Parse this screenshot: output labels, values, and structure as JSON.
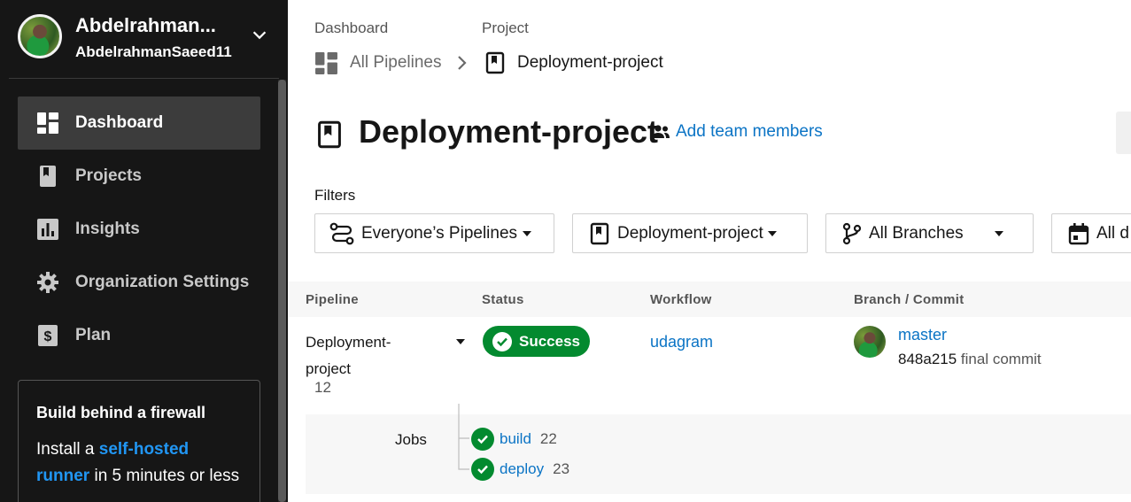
{
  "sidebar": {
    "profile": {
      "name": "Abdelrahman...",
      "username": "AbdelrahmanSaeed11"
    },
    "nav": [
      {
        "label": "Dashboard",
        "icon": "dashboard-icon",
        "active": true
      },
      {
        "label": "Projects",
        "icon": "project-icon",
        "active": false
      },
      {
        "label": "Insights",
        "icon": "insights-icon",
        "active": false
      },
      {
        "label": "Organization Settings",
        "icon": "gear-icon",
        "active": false
      },
      {
        "label": "Plan",
        "icon": "dollar-icon",
        "active": false
      }
    ],
    "promo": {
      "title": "Build behind a firewall",
      "text_before": "Install a",
      "link": "self-hosted runner",
      "text_after": "in 5 minutes or less"
    }
  },
  "breadcrumb": {
    "dashboard_label": "Dashboard",
    "project_label": "Project",
    "all_pipelines": "All Pipelines",
    "current": "Deployment-project"
  },
  "page": {
    "title": "Deployment-project",
    "add_team": "Add team members"
  },
  "filters": {
    "label": "Filters",
    "pipelines": "Everyone’s Pipelines",
    "project": "Deployment-project",
    "branches": "All Branches",
    "date": "All d"
  },
  "table": {
    "headers": {
      "pipeline": "Pipeline",
      "status": "Status",
      "workflow": "Workflow",
      "branch": "Branch / Commit"
    },
    "row": {
      "pipeline_line1": "Deployment-",
      "pipeline_line2": "project",
      "number": "12",
      "status": "Success",
      "workflow": "udagram",
      "branch": "master",
      "commit_hash": "848a215",
      "commit_msg": "final commit"
    },
    "jobs": {
      "label": "Jobs",
      "items": [
        {
          "name": "build",
          "number": "22"
        },
        {
          "name": "deploy",
          "number": "23"
        }
      ]
    }
  },
  "colors": {
    "sidebar_bg": "#161616",
    "success": "#038a2f",
    "link": "#0b74c5",
    "promo_link": "#2196f3"
  }
}
